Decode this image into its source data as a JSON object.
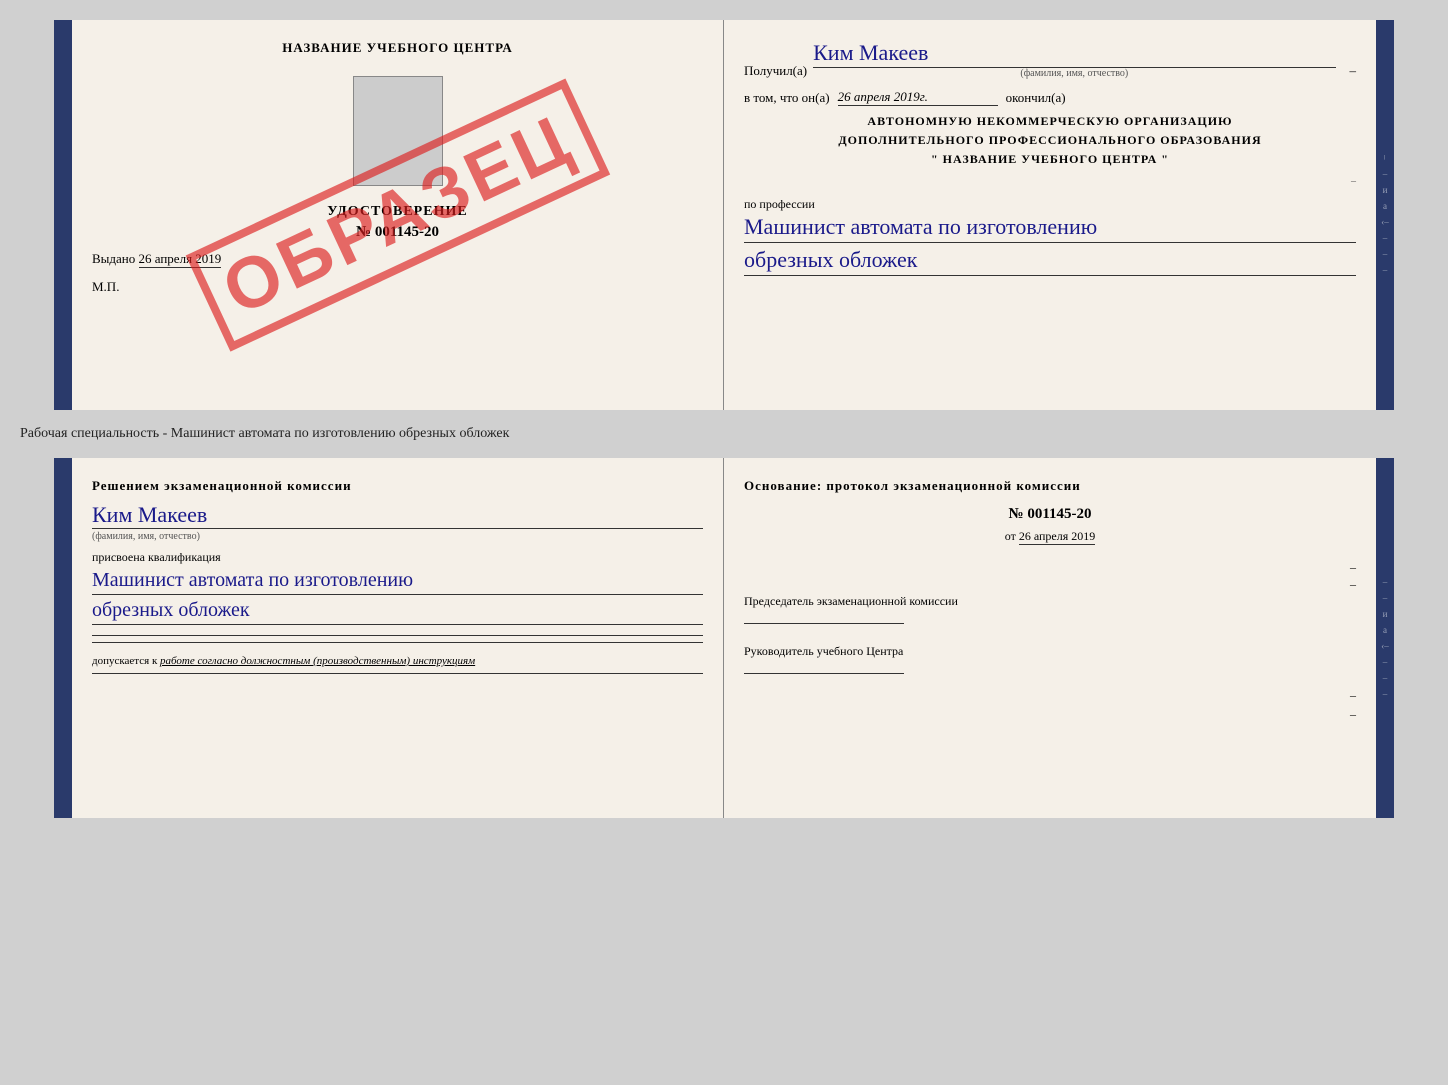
{
  "top_doc": {
    "left": {
      "school_name": "НАЗВАНИЕ УЧЕБНОГО ЦЕНТРА",
      "cert_title": "УДОСТОВЕРЕНИЕ",
      "cert_number": "№ 001145-20",
      "vydano_label": "Выдано",
      "vydano_date": "26 апреля 2019",
      "mp_label": "М.П.",
      "stamp_text": "ОБРАЗЕЦ"
    },
    "right": {
      "poluchil_label": "Получил(a)",
      "recipient_name": "Ким Макеев",
      "fio_sublabel": "(фамилия, имя, отчество)",
      "vtom_label": "в том, что он(а)",
      "date_value": "26 апреля 2019г.",
      "okonchil_label": "окончил(а)",
      "org_line1": "АВТОНОМНУЮ НЕКОММЕРЧЕСКУЮ ОРГАНИЗАЦИЮ",
      "org_line2": "ДОПОЛНИТЕЛЬНОГО ПРОФЕССИОНАЛЬНОГО ОБРАЗОВАНИЯ",
      "org_quote": "\"  НАЗВАНИЕ УЧЕБНОГО ЦЕНТРА  \"",
      "po_professii_label": "по профессии",
      "profession_line1": "Машинист автомата по изготовлению",
      "profession_line2": "обрезных обложек"
    }
  },
  "middle_text": "Рабочая специальность - Машинист автомата по изготовлению обрезных обложек",
  "bottom_doc": {
    "left": {
      "resheniem_title": "Решением экзаменационной комиссии",
      "name": "Ким Макеев",
      "fio_sublabel": "(фамилия, имя, отчество)",
      "prisvoena_label": "присвоена квалификация",
      "qualification_line1": "Машинист автомата по изготовлению",
      "qualification_line2": "обрезных обложек",
      "dopuskaetsya_label": "допускается к",
      "dopuskaetsya_value": "работе согласно должностным (производственным) инструкциям"
    },
    "right": {
      "osnovanie_title": "Основание: протокол экзаменационной комиссии",
      "protocol_number": "№ 001145-20",
      "ot_label": "от",
      "ot_date": "26 апреля 2019",
      "predsedatel_title": "Председатель экзаменационной комиссии",
      "rukovoditel_title": "Руководитель учебного Центра"
    }
  }
}
